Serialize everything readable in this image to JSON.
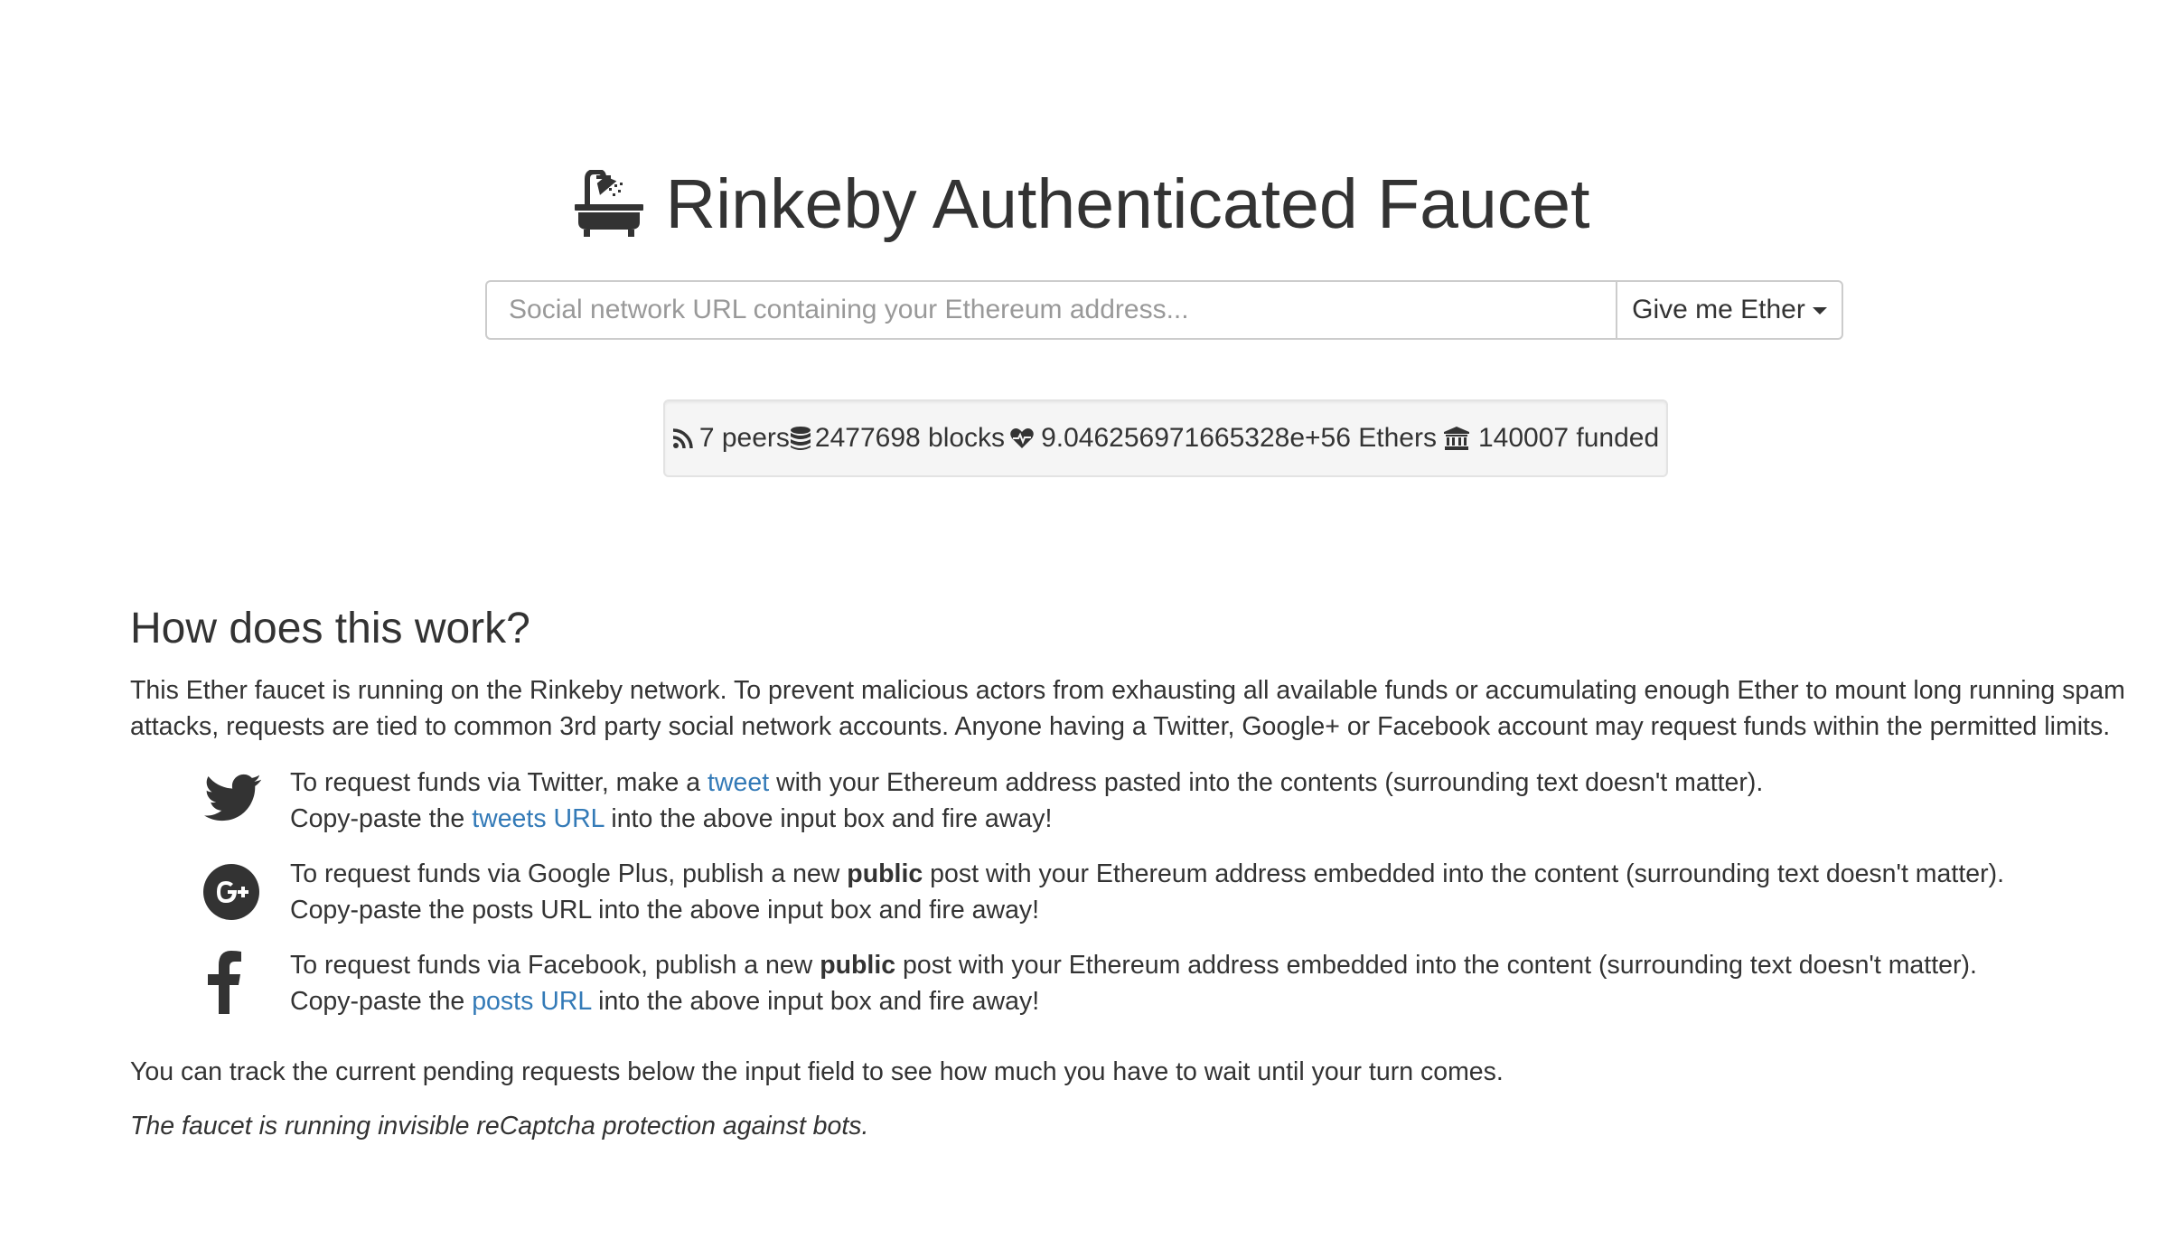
{
  "header": {
    "icon": "bath-icon",
    "title": "Rinkeby Authenticated Faucet"
  },
  "request": {
    "placeholder": "Social network URL containing your Ethereum address...",
    "value": "",
    "button_label": "Give me Ether",
    "button_icon": "caret-down-icon"
  },
  "stats": {
    "peers": "7 peers",
    "blocks": "2477698 blocks",
    "ethers": "9.046256971665328e+56 Ethers",
    "funded": "140007 funded",
    "icons": [
      "rss-icon",
      "database-icon",
      "heartbeat-icon",
      "bank-icon"
    ]
  },
  "how": {
    "title": "How does this work?",
    "intro": "This Ether faucet is running on the Rinkeby network. To prevent malicious actors from exhausting all available funds or accumulating enough Ether to mount long running spam attacks, requests are tied to common 3rd party social network accounts. Anyone having a Twitter, Google+ or Facebook account may request funds within the permitted limits.",
    "twitter": {
      "icon": "twitter-icon",
      "line1_pre": "To request funds via Twitter, make a ",
      "line1_link": "tweet",
      "line1_post": " with your Ethereum address pasted into the contents (surrounding text doesn't matter).",
      "line2_pre": "Copy-paste the ",
      "line2_link": "tweets URL",
      "line2_post": " into the above input box and fire away!"
    },
    "google": {
      "icon": "google-plus-icon",
      "line1_pre": "To request funds via Google Plus, publish a new ",
      "line1_bold": "public",
      "line1_post": " post with your Ethereum address embedded into the content (surrounding text doesn't matter).",
      "line2": "Copy-paste the posts URL into the above input box and fire away!"
    },
    "facebook": {
      "icon": "facebook-icon",
      "line1_pre": "To request funds via Facebook, publish a new ",
      "line1_bold": "public",
      "line1_post": " post with your Ethereum address embedded into the content (surrounding text doesn't matter).",
      "line2_pre": "Copy-paste the ",
      "line2_link": "posts URL",
      "line2_post": " into the above input box and fire away!"
    },
    "track": "You can track the current pending requests below the input field to see how much you have to wait until your turn comes.",
    "note": "The faucet is running invisible reCaptcha protection against bots."
  },
  "colors": {
    "text": "#333333",
    "link": "#337ab7",
    "well_bg": "#f5f5f5",
    "border": "#cccccc"
  }
}
